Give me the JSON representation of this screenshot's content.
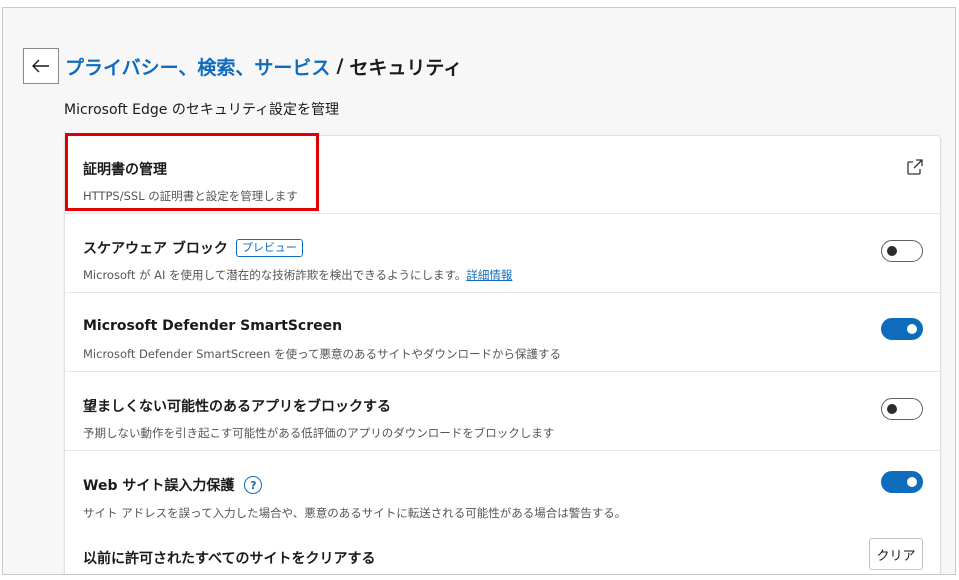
{
  "header": {
    "back_icon": "arrow-left-icon",
    "breadcrumb_link": "プライバシー、検索、サービス",
    "breadcrumb_sep": "/",
    "breadcrumb_current": "セキュリティ"
  },
  "subtitle": "Microsoft Edge のセキュリティ設定を管理",
  "rows": [
    {
      "title": "証明書の管理",
      "desc": "HTTPS/SSL の証明書と設定を管理します",
      "control": "external-link-icon"
    },
    {
      "title": "スケアウェア ブロック",
      "badge": "プレビュー",
      "desc": "Microsoft が AI を使用して潜在的な技術詐欺を検出できるようにします。",
      "link": "詳細情報",
      "toggle": "off"
    },
    {
      "title": "Microsoft Defender SmartScreen",
      "desc": "Microsoft Defender SmartScreen を使って悪意のあるサイトやダウンロードから保護する",
      "toggle": "on"
    },
    {
      "title": "望ましくない可能性のあるアプリをブロックする",
      "desc": "予期しない動作を引き起こす可能性がある低評価のアプリのダウンロードをブロックします",
      "toggle": "off"
    },
    {
      "title": "Web サイト誤入力保護",
      "help": "?",
      "desc": "サイト アドレスを誤って入力した場合や、悪意のあるサイトに転送される可能性がある場合は警告する。",
      "toggle": "on"
    },
    {
      "title": "以前に許可されたすべてのサイトをクリアする",
      "button": "クリア"
    }
  ],
  "colors": {
    "accent": "#0f6cbd",
    "highlight": "#e00000"
  }
}
